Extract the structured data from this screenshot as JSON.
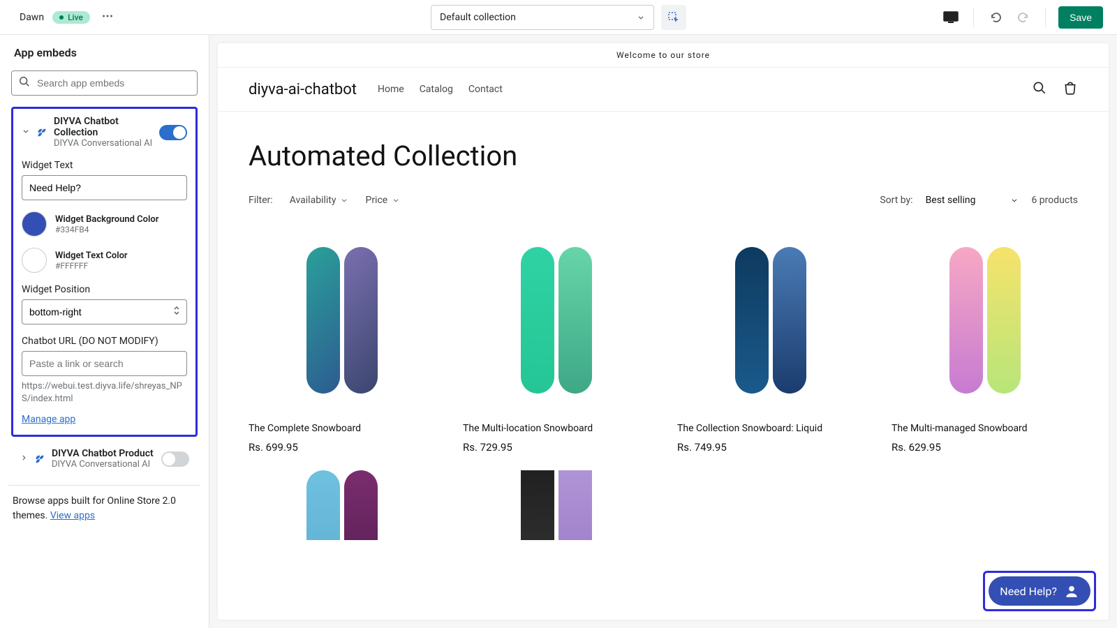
{
  "topbar": {
    "theme_name": "Dawn",
    "status_badge": "Live",
    "page_selector": "Default collection",
    "save_label": "Save"
  },
  "sidebar": {
    "title": "App embeds",
    "search_placeholder": "Search app embeds",
    "embeds": [
      {
        "title": "DIYVA Chatbot Collection",
        "subtitle": "DIYVA Conversational AI",
        "enabled": true,
        "fields": {
          "widget_text_label": "Widget Text",
          "widget_text_value": "Need Help?",
          "bg_color_label": "Widget Background Color",
          "bg_color_hex": "#334FB4",
          "text_color_label": "Widget Text Color",
          "text_color_hex": "#FFFFFF",
          "position_label": "Widget Position",
          "position_value": "bottom-right",
          "url_label": "Chatbot URL (DO NOT MODIFY)",
          "url_placeholder": "Paste a link or search",
          "url_value": "https://webui.test.diyva.life/shreyas_NPS/index.html",
          "manage_link": "Manage app"
        }
      },
      {
        "title": "DIYVA Chatbot Product",
        "subtitle": "DIYVA Conversational AI",
        "enabled": false
      }
    ],
    "browse_text": "Browse apps built for Online Store 2.0 themes. ",
    "browse_link": "View apps"
  },
  "preview": {
    "announcement": "Welcome to our store",
    "store_name": "diyva-ai-chatbot",
    "nav": [
      "Home",
      "Catalog",
      "Contact"
    ],
    "collection_title": "Automated Collection",
    "filter_label": "Filter:",
    "filter_options": [
      "Availability",
      "Price"
    ],
    "sort_label": "Sort by:",
    "sort_value": "Best selling",
    "product_count": "6 products",
    "products": [
      {
        "name": "The Complete Snowboard",
        "price": "Rs. 699.95"
      },
      {
        "name": "The Multi-location Snowboard",
        "price": "Rs. 729.95"
      },
      {
        "name": "The Collection Snowboard: Liquid",
        "price": "Rs. 749.95"
      },
      {
        "name": "The Multi-managed Snowboard",
        "price": "Rs. 629.95"
      },
      {
        "name": "",
        "price": ""
      },
      {
        "name": "",
        "price": ""
      }
    ],
    "chat_widget_text": "Need Help?"
  }
}
